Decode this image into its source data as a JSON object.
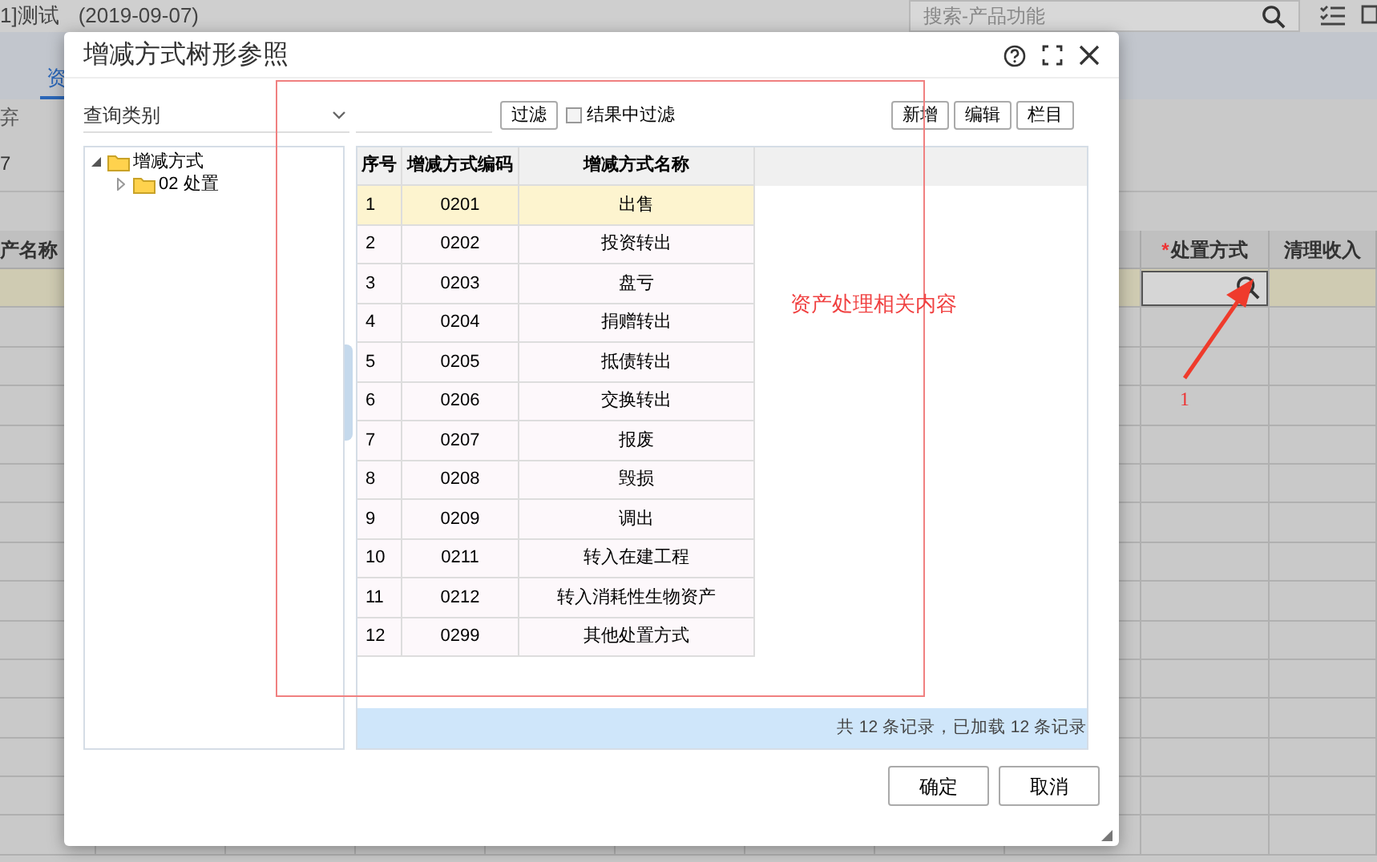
{
  "app": {
    "title": "1]测试",
    "date": "(2019-09-07)",
    "search_placeholder": "搜索-产品功能",
    "tab": "资",
    "toolbar_text": "弃",
    "field_value": "7"
  },
  "grid": {
    "columns": [
      {
        "label": "产名称"
      },
      {
        "label": "处置方式",
        "required_mark": "*"
      },
      {
        "label": "清理收入"
      }
    ]
  },
  "annotation": {
    "number": "1",
    "note": "资产处理相关内容"
  },
  "dialog": {
    "title": "增减方式树形参照",
    "category_select": "查询类别",
    "filter_button": "过滤",
    "filter_in_results": {
      "label": "结果中过滤",
      "checked": false
    },
    "toolbar_buttons": [
      "新增",
      "编辑",
      "栏目"
    ],
    "tree": [
      {
        "label": "增减方式",
        "expanded": true,
        "children": [
          {
            "label": "02 处置",
            "expanded": false
          }
        ]
      }
    ],
    "table": {
      "columns": [
        "序号",
        "增减方式编码",
        "增减方式名称"
      ],
      "rows": [
        {
          "cells": [
            "1",
            "0201",
            "出售"
          ],
          "selected": true
        },
        {
          "cells": [
            "2",
            "0202",
            "投资转出"
          ],
          "selected": false
        },
        {
          "cells": [
            "3",
            "0203",
            "盘亏"
          ],
          "selected": false
        },
        {
          "cells": [
            "4",
            "0204",
            "捐赠转出"
          ],
          "selected": false
        },
        {
          "cells": [
            "5",
            "0205",
            "抵债转出"
          ],
          "selected": false
        },
        {
          "cells": [
            "6",
            "0206",
            "交换转出"
          ],
          "selected": false
        },
        {
          "cells": [
            "7",
            "0207",
            "报废"
          ],
          "selected": false
        },
        {
          "cells": [
            "8",
            "0208",
            "毁损"
          ],
          "selected": false
        },
        {
          "cells": [
            "9",
            "0209",
            "调出"
          ],
          "selected": false
        },
        {
          "cells": [
            "10",
            "0211",
            "转入在建工程"
          ],
          "selected": false
        },
        {
          "cells": [
            "11",
            "0212",
            "转入消耗性生物资产"
          ],
          "selected": false
        },
        {
          "cells": [
            "12",
            "0299",
            "其他处置方式"
          ],
          "selected": false
        }
      ]
    },
    "footer": "共 12 条记录，已加载 12 条记录",
    "buttons": [
      "确定",
      "取消"
    ]
  }
}
